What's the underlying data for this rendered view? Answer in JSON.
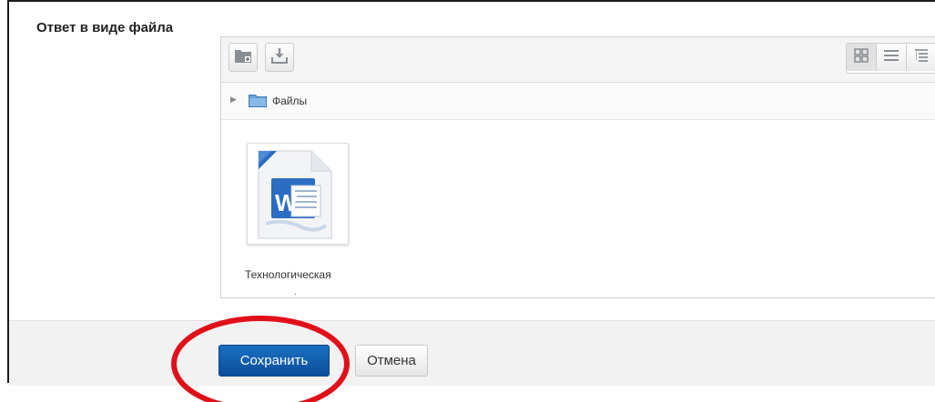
{
  "form": {
    "field_label": "Ответ в виде файла"
  },
  "filemanager": {
    "toolbar": {
      "icons": [
        "create-folder-icon",
        "download-icon"
      ],
      "view_icons": [
        "grid-view-icon",
        "list-view-icon",
        "tree-view-icon"
      ],
      "active_view": "grid-view-icon"
    },
    "path": {
      "folder_label": "Файлы"
    },
    "files": [
      {
        "name": "Технологическая",
        "suffix": ".",
        "icon": "word-document-icon"
      }
    ]
  },
  "footer": {
    "save_label": "Сохранить",
    "cancel_label": "Отмена"
  },
  "colors": {
    "save_button": "#0b4f9a",
    "highlight": "#e0101a",
    "word_blue": "#2b6cc4"
  }
}
